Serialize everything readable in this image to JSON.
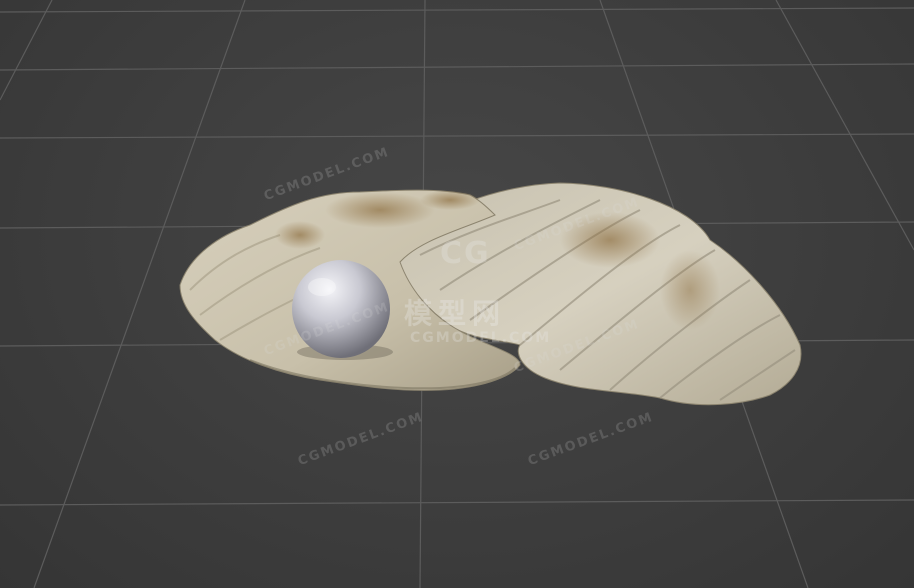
{
  "watermark": {
    "brand_text": "CGMODEL.COM",
    "logo_letters": "CG",
    "logo_chinese": "模型网",
    "logo_subtitle": "CGMODEL.COM"
  },
  "scene": {
    "background_color": "#3c3c3c",
    "grid_color": "#5a5a5a",
    "shell_color": "#cfc8b6",
    "pearl_color": "#d9d9e2"
  }
}
